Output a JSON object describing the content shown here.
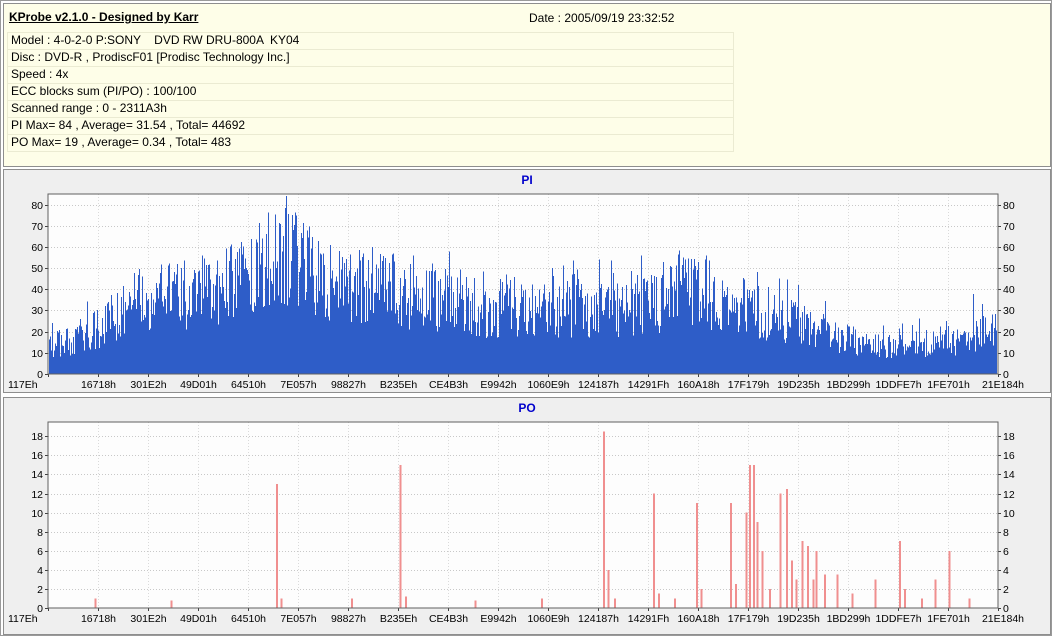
{
  "colors": {
    "header_bg": "#fefee8",
    "panel_bg": "#efefef",
    "plot_bg": "#fdfdfd",
    "chart_title": "#0000cc",
    "pi_bar": "#2e5dc8",
    "po_bar": "#f08f8f",
    "grid": "#c8c8c8",
    "grid_v": "#dadada"
  },
  "header": {
    "app_title": "KProbe v2.1.0 - Designed by Karr",
    "date_label": "Date : 2005/09/19 23:32:52",
    "info_rows": [
      "Model : 4-0-2-0 P:SONY    DVD RW DRU-800A  KY04",
      "Disc : DVD-R , ProdiscF01 [Prodisc Technology Inc.]",
      "Speed : 4x",
      "ECC blocks sum (PI/PO) : 100/100",
      "Scanned range : 0 - 2311A3h",
      "PI Max= 84 , Average= 31.54 , Total= 44692",
      "PO Max= 19 , Average= 0.34 , Total= 483"
    ]
  },
  "chart_data": [
    {
      "type": "bar",
      "title": "PI",
      "color": "#2e5dc8",
      "ylim": [
        0,
        85
      ],
      "yticks": [
        0,
        10,
        20,
        30,
        40,
        50,
        60,
        70,
        80
      ],
      "grid": true,
      "x_labels": [
        "117Eh",
        "16718h",
        "301E2h",
        "49D01h",
        "64510h",
        "7E057h",
        "98827h",
        "B235Eh",
        "CE4B3h",
        "E9942h",
        "1060E9h",
        "124187h",
        "14291Fh",
        "160A18h",
        "17F179h",
        "19D235h",
        "1BD299h",
        "1DDFE7h",
        "1FE701h",
        "21E184h"
      ],
      "stats": {
        "max": 84,
        "average": 31.54,
        "total": 44692
      },
      "envelope_format": "[x_fraction, typical_value, peak_value] estimated from chart",
      "envelope": [
        [
          0.0,
          13,
          28
        ],
        [
          0.03,
          17,
          32
        ],
        [
          0.06,
          24,
          42
        ],
        [
          0.09,
          33,
          52
        ],
        [
          0.12,
          36,
          56
        ],
        [
          0.15,
          36,
          58
        ],
        [
          0.18,
          40,
          60
        ],
        [
          0.21,
          47,
          66
        ],
        [
          0.235,
          55,
          78
        ],
        [
          0.25,
          58,
          84
        ],
        [
          0.265,
          52,
          72
        ],
        [
          0.29,
          46,
          66
        ],
        [
          0.32,
          41,
          60
        ],
        [
          0.35,
          39,
          62
        ],
        [
          0.38,
          36,
          58
        ],
        [
          0.42,
          33,
          62
        ],
        [
          0.46,
          31,
          54
        ],
        [
          0.5,
          29,
          50
        ],
        [
          0.53,
          30,
          55
        ],
        [
          0.56,
          31,
          62
        ],
        [
          0.59,
          29,
          52
        ],
        [
          0.62,
          31,
          66
        ],
        [
          0.645,
          33,
          66
        ],
        [
          0.665,
          44,
          68
        ],
        [
          0.685,
          41,
          64
        ],
        [
          0.71,
          33,
          56
        ],
        [
          0.74,
          30,
          50
        ],
        [
          0.77,
          26,
          47
        ],
        [
          0.8,
          22,
          42
        ],
        [
          0.83,
          17,
          35
        ],
        [
          0.86,
          14,
          30
        ],
        [
          0.89,
          13,
          28
        ],
        [
          0.92,
          14,
          30
        ],
        [
          0.95,
          15,
          34
        ],
        [
          0.975,
          17,
          40
        ],
        [
          1.0,
          21,
          44
        ]
      ],
      "noise_seed": 20050919
    },
    {
      "type": "bar",
      "title": "PO",
      "color": "#f08f8f",
      "ylim": [
        0,
        19.5
      ],
      "yticks": [
        0,
        2,
        4,
        6,
        8,
        10,
        12,
        14,
        16,
        18
      ],
      "grid": true,
      "x_labels": [
        "117Eh",
        "16718h",
        "301E2h",
        "49D01h",
        "64510h",
        "7E057h",
        "98827h",
        "B235Eh",
        "CE4B3h",
        "E9942h",
        "1060E9h",
        "124187h",
        "14291Fh",
        "160A18h",
        "17F179h",
        "19D235h",
        "1BD299h",
        "1DDFE7h",
        "1FE701h",
        "21E184h"
      ],
      "stats": {
        "max": 19,
        "average": 0.34,
        "total": 483
      },
      "spikes_format": "[x_fraction, value] estimated from chart",
      "spikes": [
        [
          0.05,
          1
        ],
        [
          0.13,
          0.8
        ],
        [
          0.241,
          13
        ],
        [
          0.246,
          1
        ],
        [
          0.32,
          1
        ],
        [
          0.371,
          15
        ],
        [
          0.377,
          1.2
        ],
        [
          0.45,
          0.8
        ],
        [
          0.52,
          1
        ],
        [
          0.585,
          18.5
        ],
        [
          0.59,
          4
        ],
        [
          0.597,
          1
        ],
        [
          0.638,
          12
        ],
        [
          0.643,
          1.5
        ],
        [
          0.66,
          1
        ],
        [
          0.683,
          11
        ],
        [
          0.688,
          2
        ],
        [
          0.719,
          11
        ],
        [
          0.724,
          2.5
        ],
        [
          0.735,
          10
        ],
        [
          0.739,
          15
        ],
        [
          0.743,
          15
        ],
        [
          0.747,
          9
        ],
        [
          0.752,
          6
        ],
        [
          0.76,
          2
        ],
        [
          0.771,
          12
        ],
        [
          0.778,
          12.5
        ],
        [
          0.783,
          5
        ],
        [
          0.788,
          3
        ],
        [
          0.794,
          7
        ],
        [
          0.8,
          6.5
        ],
        [
          0.806,
          3
        ],
        [
          0.809,
          6
        ],
        [
          0.818,
          3.5
        ],
        [
          0.831,
          3.5
        ],
        [
          0.847,
          1.5
        ],
        [
          0.871,
          3
        ],
        [
          0.897,
          7
        ],
        [
          0.902,
          2
        ],
        [
          0.92,
          1
        ],
        [
          0.934,
          3
        ],
        [
          0.949,
          6
        ],
        [
          0.97,
          1
        ]
      ]
    }
  ]
}
